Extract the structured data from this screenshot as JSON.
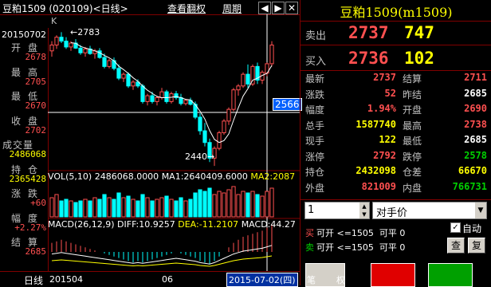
{
  "topbar": {
    "symbol_label": "豆粕1509 (020109)<日线>",
    "rights_link": "查看翻权",
    "period_link": "周期"
  },
  "left_info": {
    "date": "20150702",
    "rows": [
      {
        "label": "开盘",
        "value": "2678"
      },
      {
        "label": "最高",
        "value": "2705"
      },
      {
        "label": "最低",
        "value": "2670"
      },
      {
        "label": "收盘",
        "value": "2702"
      },
      {
        "label": "成交量",
        "value": "2486068"
      },
      {
        "label": "持仓",
        "value": "2365428"
      },
      {
        "label": "涨跌",
        "value": "+60"
      },
      {
        "label": "幅度",
        "value": "+2.27%"
      },
      {
        "label": "结算",
        "value": "2685"
      }
    ]
  },
  "chart_labels": {
    "k_label": "K",
    "high_marker": "2783",
    "low_marker": "2440",
    "price_tag": "2566",
    "vol_label": "VOL(5,10)",
    "vol_value": "2486068.0000",
    "ma1_label": "MA1:2640409.6000",
    "ma2_label": "MA2:2087",
    "macd_label": "MACD(26,12,9)",
    "diff_label": "DIFF:10.9257",
    "dea_label": "DEA:-11.2107",
    "macd_value": "MACD:44.27"
  },
  "bottombar": {
    "period": "日线",
    "date_start": "201504",
    "date_mid": "06",
    "date_cursor": "2015-07-02(四)"
  },
  "quote": {
    "title": "豆粕1509(m1509)",
    "sell_label": "卖出",
    "sell_price": "2737",
    "sell_qty": "747",
    "buy_label": "买入",
    "buy_price": "2736",
    "buy_qty": "102",
    "stats": [
      [
        {
          "k": "最新",
          "v": "2737",
          "c": "red"
        },
        {
          "k": "结算",
          "v": "2711",
          "c": "red"
        }
      ],
      [
        {
          "k": "涨跌",
          "v": "52",
          "c": "red"
        },
        {
          "k": "昨结",
          "v": "2685",
          "c": "white"
        }
      ],
      [
        {
          "k": "幅度",
          "v": "1.94%",
          "c": "red"
        },
        {
          "k": "开盘",
          "v": "2690",
          "c": "red"
        }
      ],
      [
        {
          "k": "总手",
          "v": "1587740",
          "c": "yellow"
        },
        {
          "k": "最高",
          "v": "2738",
          "c": "red"
        }
      ],
      [
        {
          "k": "现手",
          "v": "122",
          "c": "yellow"
        },
        {
          "k": "最低",
          "v": "2685",
          "c": "white"
        }
      ],
      [
        {
          "k": "涨停",
          "v": "2792",
          "c": "red"
        },
        {
          "k": "跌停",
          "v": "2578",
          "c": "green"
        }
      ],
      [
        {
          "k": "持仓",
          "v": "2432098",
          "c": "yellow"
        },
        {
          "k": "仓差",
          "v": "66670",
          "c": "yellow"
        }
      ],
      [
        {
          "k": "外盘",
          "v": "821009",
          "c": "red"
        },
        {
          "k": "内盘",
          "v": "766731",
          "c": "green"
        }
      ]
    ]
  },
  "order": {
    "qty_value": "1",
    "direction_value": "对手价",
    "auto_label": "自动",
    "buy_tag": "买",
    "buy_line": "可开 <=1505  可平 0",
    "sell_tag": "卖",
    "sell_line": "可开 <=1505  可平 0",
    "query_btn": "查",
    "clear_btn": "复",
    "tab_pen": "笔",
    "tab_right": "权"
  },
  "colors": {
    "up": "#ff5050",
    "down": "#00ffff",
    "border": "#800000",
    "ma_white": "#ffffff",
    "ma_yellow": "#ffff00",
    "ma_magenta": "#ff00ff"
  },
  "chart_data": {
    "type": "candlestick",
    "ohlc": [
      {
        "o": 2735,
        "h": 2760,
        "l": 2720,
        "c": 2750
      },
      {
        "o": 2750,
        "h": 2775,
        "l": 2740,
        "c": 2770
      },
      {
        "o": 2770,
        "h": 2783,
        "l": 2755,
        "c": 2760
      },
      {
        "o": 2760,
        "h": 2770,
        "l": 2740,
        "c": 2745
      },
      {
        "o": 2745,
        "h": 2760,
        "l": 2735,
        "c": 2755
      },
      {
        "o": 2755,
        "h": 2765,
        "l": 2740,
        "c": 2742
      },
      {
        "o": 2742,
        "h": 2750,
        "l": 2725,
        "c": 2730
      },
      {
        "o": 2730,
        "h": 2745,
        "l": 2720,
        "c": 2740
      },
      {
        "o": 2740,
        "h": 2748,
        "l": 2725,
        "c": 2728
      },
      {
        "o": 2728,
        "h": 2740,
        "l": 2715,
        "c": 2735
      },
      {
        "o": 2735,
        "h": 2742,
        "l": 2715,
        "c": 2718
      },
      {
        "o": 2718,
        "h": 2728,
        "l": 2690,
        "c": 2695
      },
      {
        "o": 2695,
        "h": 2715,
        "l": 2690,
        "c": 2710
      },
      {
        "o": 2710,
        "h": 2718,
        "l": 2685,
        "c": 2690
      },
      {
        "o": 2690,
        "h": 2700,
        "l": 2660,
        "c": 2665
      },
      {
        "o": 2665,
        "h": 2680,
        "l": 2655,
        "c": 2675
      },
      {
        "o": 2675,
        "h": 2680,
        "l": 2640,
        "c": 2645
      },
      {
        "o": 2645,
        "h": 2660,
        "l": 2635,
        "c": 2655
      },
      {
        "o": 2655,
        "h": 2662,
        "l": 2640,
        "c": 2645
      },
      {
        "o": 2645,
        "h": 2650,
        "l": 2600,
        "c": 2605
      },
      {
        "o": 2605,
        "h": 2625,
        "l": 2595,
        "c": 2620
      },
      {
        "o": 2620,
        "h": 2630,
        "l": 2600,
        "c": 2605
      },
      {
        "o": 2605,
        "h": 2620,
        "l": 2595,
        "c": 2615
      },
      {
        "o": 2615,
        "h": 2640,
        "l": 2610,
        "c": 2630
      },
      {
        "o": 2630,
        "h": 2635,
        "l": 2600,
        "c": 2605
      },
      {
        "o": 2605,
        "h": 2630,
        "l": 2600,
        "c": 2625
      },
      {
        "o": 2625,
        "h": 2632,
        "l": 2610,
        "c": 2615
      },
      {
        "o": 2615,
        "h": 2625,
        "l": 2595,
        "c": 2600
      },
      {
        "o": 2600,
        "h": 2612,
        "l": 2595,
        "c": 2608
      },
      {
        "o": 2608,
        "h": 2615,
        "l": 2595,
        "c": 2598
      },
      {
        "o": 2598,
        "h": 2605,
        "l": 2560,
        "c": 2565
      },
      {
        "o": 2565,
        "h": 2575,
        "l": 2520,
        "c": 2530
      },
      {
        "o": 2530,
        "h": 2550,
        "l": 2490,
        "c": 2500
      },
      {
        "o": 2500,
        "h": 2510,
        "l": 2450,
        "c": 2460
      },
      {
        "o": 2460,
        "h": 2490,
        "l": 2440,
        "c": 2485
      },
      {
        "o": 2485,
        "h": 2530,
        "l": 2480,
        "c": 2525
      },
      {
        "o": 2525,
        "h": 2560,
        "l": 2520,
        "c": 2555
      },
      {
        "o": 2555,
        "h": 2590,
        "l": 2545,
        "c": 2585
      },
      {
        "o": 2585,
        "h": 2640,
        "l": 2580,
        "c": 2635
      },
      {
        "o": 2635,
        "h": 2650,
        "l": 2620,
        "c": 2645
      },
      {
        "o": 2645,
        "h": 2680,
        "l": 2640,
        "c": 2675
      },
      {
        "o": 2675,
        "h": 2700,
        "l": 2640,
        "c": 2650
      },
      {
        "o": 2650,
        "h": 2700,
        "l": 2645,
        "c": 2695
      },
      {
        "o": 2695,
        "h": 2705,
        "l": 2650,
        "c": 2660
      },
      {
        "o": 2660,
        "h": 2685,
        "l": 2650,
        "c": 2680
      },
      {
        "o": 2678,
        "h": 2705,
        "l": 2670,
        "c": 2702
      },
      {
        "o": 2702,
        "h": 2760,
        "l": 2695,
        "c": 2750
      }
    ],
    "volume_rel": [
      0.6,
      0.7,
      0.5,
      0.55,
      0.5,
      0.45,
      0.5,
      0.55,
      0.5,
      0.6,
      0.55,
      0.7,
      0.6,
      0.55,
      0.75,
      0.6,
      0.65,
      0.55,
      0.5,
      0.7,
      0.6,
      0.5,
      0.55,
      0.6,
      0.65,
      0.55,
      0.5,
      0.6,
      0.5,
      0.55,
      0.75,
      0.85,
      0.8,
      0.9,
      0.7,
      0.8,
      0.75,
      0.85,
      0.95,
      0.7,
      0.8,
      0.75,
      0.8,
      0.7,
      0.65,
      0.8,
      0.9
    ],
    "macd": [
      0.3,
      0.35,
      0.4,
      0.35,
      0.3,
      0.25,
      0.2,
      0.15,
      0.1,
      0.05,
      0,
      -0.05,
      -0.1,
      -0.15,
      -0.2,
      -0.25,
      -0.3,
      -0.35,
      -0.3,
      -0.35,
      -0.3,
      -0.25,
      -0.2,
      -0.15,
      -0.1,
      -0.05,
      0,
      -0.05,
      -0.1,
      -0.15,
      -0.2,
      -0.3,
      -0.35,
      -0.4,
      -0.3,
      -0.15,
      0,
      0.15,
      0.3,
      0.4,
      0.5,
      0.55,
      0.6,
      0.65,
      0.7,
      0.8,
      0.9
    ],
    "ylim": [
      2430,
      2800
    ]
  }
}
